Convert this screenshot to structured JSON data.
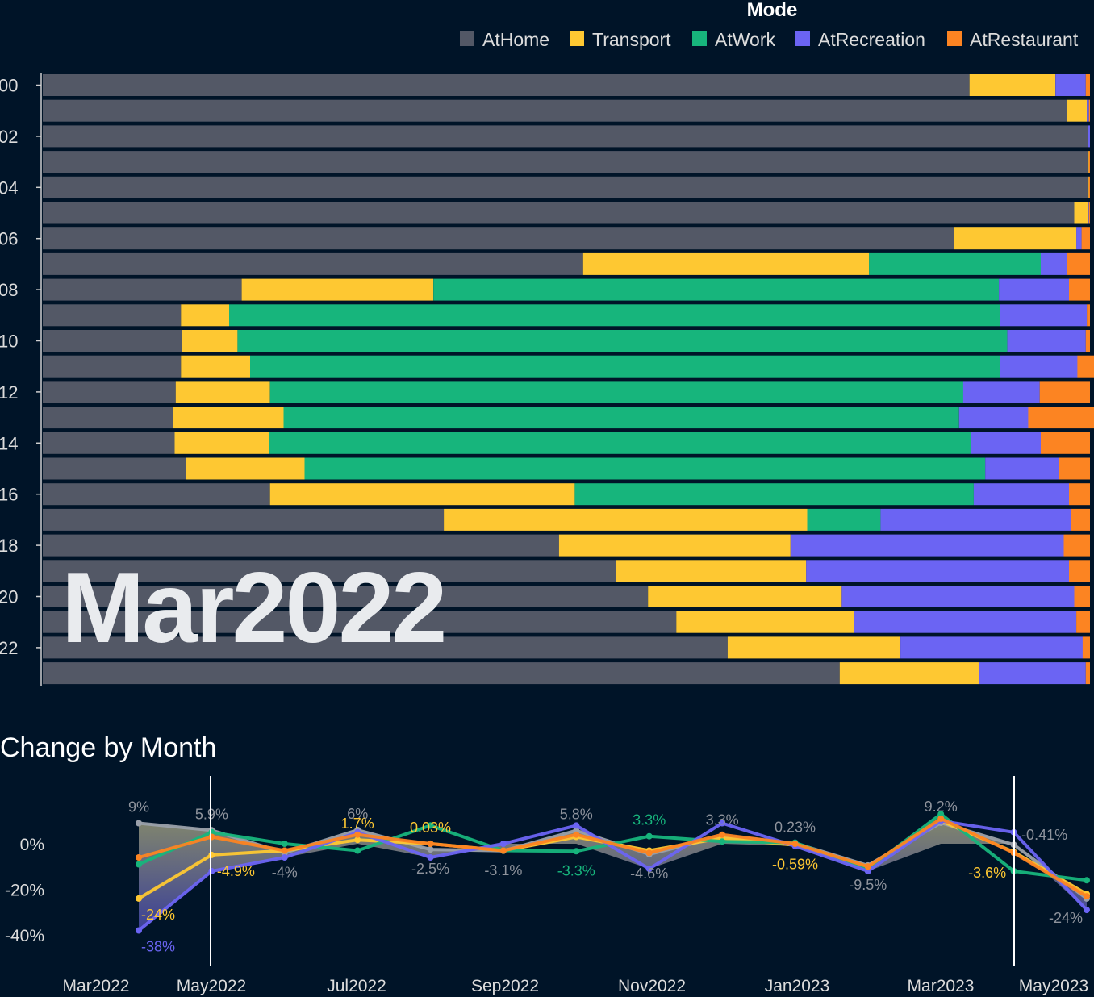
{
  "colors": {
    "background": "#001428",
    "AtHome": "#535866",
    "Transport": "#fec832",
    "AtWork": "#17b57c",
    "AtRecreation": "#6b64f3",
    "AtRestaurant": "#fc8422",
    "axis_text": "#dcdcdc"
  },
  "chart_data": [
    {
      "type": "bar",
      "orientation": "horizontal",
      "stacked": "100%",
      "title": "",
      "legend_title": "Mode",
      "legend_position": "top-right",
      "watermark_label": "Mar2022",
      "categories": [
        "00",
        "01",
        "02",
        "03",
        "04",
        "05",
        "06",
        "07",
        "08",
        "09",
        "10",
        "11",
        "12",
        "13",
        "14",
        "15",
        "16",
        "17",
        "18",
        "19",
        "20",
        "21",
        "22",
        "23"
      ],
      "tick_labels": [
        "00",
        "02",
        "04",
        "06",
        "08",
        "10",
        "12",
        "14",
        "16",
        "18",
        "20",
        "22"
      ],
      "xlim": [
        0,
        100
      ],
      "series": [
        {
          "name": "AtHome",
          "values": [
            88.5,
            97.8,
            99.8,
            99.8,
            99.8,
            98.5,
            87.0,
            51.6,
            19.0,
            13.2,
            13.3,
            13.2,
            12.7,
            12.4,
            12.6,
            13.7,
            21.7,
            38.3,
            49.3,
            54.7,
            57.8,
            60.5,
            65.4,
            76.1
          ]
        },
        {
          "name": "Transport",
          "values": [
            8.2,
            1.9,
            0.0,
            0.1,
            0.1,
            1.3,
            11.7,
            27.3,
            18.3,
            4.6,
            5.3,
            6.6,
            9.0,
            10.6,
            9.0,
            11.3,
            29.1,
            34.7,
            22.1,
            18.2,
            18.5,
            17.0,
            16.5,
            13.3
          ]
        },
        {
          "name": "AtWork",
          "values": [
            0.0,
            0.0,
            0.0,
            0.0,
            0.0,
            0.0,
            0.0,
            16.4,
            54.0,
            73.6,
            73.5,
            71.6,
            66.2,
            64.5,
            67.0,
            65.0,
            38.1,
            7.0,
            0.0,
            0.0,
            0.0,
            0.0,
            0.0,
            0.0
          ]
        },
        {
          "name": "AtRecreation",
          "values": [
            2.9,
            0.2,
            0.2,
            0.0,
            0.0,
            0.1,
            0.5,
            2.5,
            6.7,
            8.3,
            7.5,
            7.4,
            7.3,
            6.6,
            6.7,
            7.0,
            9.1,
            18.2,
            26.1,
            25.1,
            22.2,
            21.2,
            17.4,
            10.2
          ]
        },
        {
          "name": "AtRestaurant",
          "values": [
            0.4,
            0.1,
            0.0,
            0.1,
            0.1,
            0.1,
            0.8,
            2.2,
            2.0,
            0.3,
            0.4,
            1.8,
            4.8,
            6.3,
            4.7,
            3.0,
            2.0,
            1.8,
            2.5,
            2.0,
            1.5,
            1.3,
            0.7,
            0.4
          ]
        }
      ]
    },
    {
      "type": "line",
      "title": "Change by Month",
      "x": [
        "Mar2022",
        "Apr2022",
        "May2022",
        "Jun2022",
        "Jul2022",
        "Aug2022",
        "Sep2022",
        "Oct2022",
        "Nov2022",
        "Dec2022",
        "Jan2023",
        "Feb2023",
        "Mar2023",
        "Apr2023",
        "May2023"
      ],
      "x_tick_labels": [
        "Mar2022",
        "May2022",
        "Jul2022",
        "Sep2022",
        "Nov2022",
        "Jan2023",
        "Mar2023",
        "May2023"
      ],
      "y_tick_labels": [
        "0%",
        "-20%",
        "-40%"
      ],
      "ylim": [
        -45,
        15
      ],
      "highlight_range": [
        "Apr2022",
        "Apr2023"
      ],
      "series": [
        {
          "name": "AtHome",
          "values": [
            9,
            5.9,
            -4,
            6,
            -2.5,
            -3.1,
            5.8,
            -4.6,
            3.3,
            0.23,
            -9.5,
            9.2,
            -0.41,
            -24,
            null
          ]
        },
        {
          "name": "Transport",
          "values": [
            -24,
            -4.9,
            -3,
            1.7,
            0.03,
            -3,
            3,
            -3,
            2.5,
            -0.59,
            -10,
            10,
            -3.6,
            -22,
            null
          ]
        },
        {
          "name": "AtWork",
          "values": [
            -9,
            5,
            0,
            -3,
            8,
            -3,
            -3.3,
            3.3,
            1,
            0.5,
            -11,
            13,
            -12,
            -16,
            null
          ]
        },
        {
          "name": "AtRecreation",
          "values": [
            -38,
            -12,
            -6,
            5,
            -6,
            0,
            8,
            -11,
            9,
            -1,
            -12,
            10,
            5,
            -29,
            null
          ]
        },
        {
          "name": "AtRestaurant",
          "values": [
            -6,
            3,
            -3,
            4,
            0,
            -3,
            4,
            -4,
            4,
            0,
            -10,
            11,
            -4,
            -23,
            null
          ]
        }
      ],
      "point_labels": [
        {
          "text": "9%",
          "series": "AtHome",
          "index": 0
        },
        {
          "text": "5.9%",
          "series": "AtHome",
          "index": 1
        },
        {
          "text": "-4%",
          "series": "AtHome",
          "index": 2
        },
        {
          "text": "6%",
          "series": "AtHome",
          "index": 3
        },
        {
          "text": "-2.5%",
          "series": "AtHome",
          "index": 4
        },
        {
          "text": "-3.1%",
          "series": "AtHome",
          "index": 5
        },
        {
          "text": "5.8%",
          "series": "AtHome",
          "index": 6
        },
        {
          "text": "-4.6%",
          "series": "AtHome",
          "index": 7
        },
        {
          "text": "3.3%",
          "series": "AtHome",
          "index": 8
        },
        {
          "text": "0.23%",
          "series": "AtHome",
          "index": 9
        },
        {
          "text": "-9.5%",
          "series": "AtHome",
          "index": 10
        },
        {
          "text": "9.2%",
          "series": "AtHome",
          "index": 11
        },
        {
          "text": "-0.41%",
          "series": "AtHome",
          "index": 12
        },
        {
          "text": "-24%",
          "series": "AtHome",
          "index": 13
        },
        {
          "text": "-24%",
          "series": "Transport",
          "index": 0
        },
        {
          "text": "-4.9%",
          "series": "Transport",
          "index": 1
        },
        {
          "text": "1.7%",
          "series": "Transport",
          "index": 3
        },
        {
          "text": "0.03%",
          "series": "Transport",
          "index": 4
        },
        {
          "text": "-0.59%",
          "series": "Transport",
          "index": 9
        },
        {
          "text": "-3.6%",
          "series": "Transport",
          "index": 12
        },
        {
          "text": "3.3%",
          "series": "AtWork",
          "index": 7
        },
        {
          "text": "-3.3%",
          "series": "AtWork",
          "index": 6
        },
        {
          "text": "-38%",
          "series": "AtRecreation",
          "index": 0
        }
      ]
    }
  ]
}
